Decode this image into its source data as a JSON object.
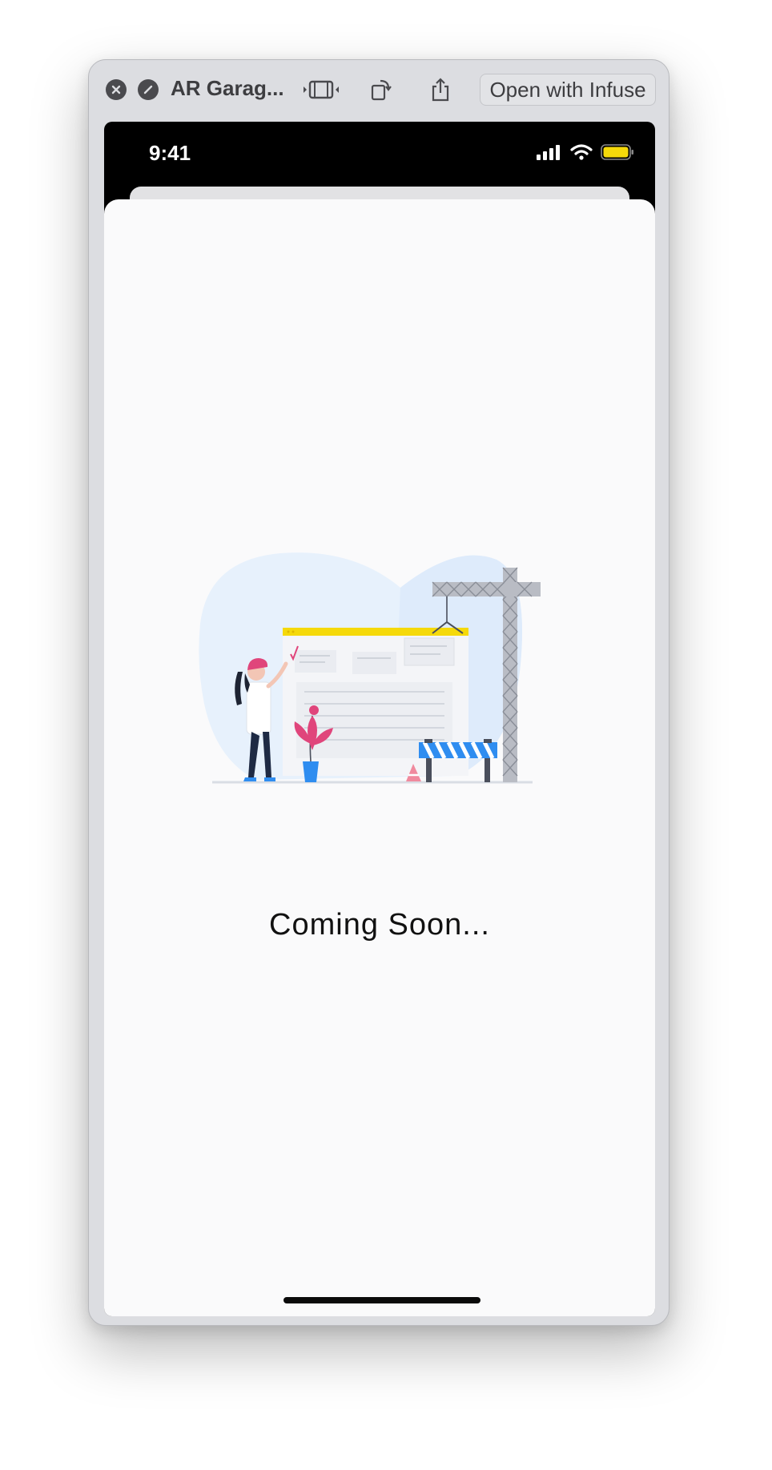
{
  "titlebar": {
    "title": "AR Garag...",
    "open_button_label": "Open with Infuse",
    "icons": [
      "close-icon",
      "block-icon",
      "video-frame-icon",
      "rotate-icon",
      "share-icon"
    ]
  },
  "status_bar": {
    "time": "9:41",
    "icons": [
      "signal-icon",
      "wifi-icon",
      "battery-icon"
    ],
    "battery_color": "#f5d90a"
  },
  "main": {
    "message": "Coming Soon...",
    "illustration": "under-construction-illustration"
  },
  "colors": {
    "window_chrome": "#dcdde1",
    "sheet_background": "#fafafb",
    "accent_yellow": "#f5d90a",
    "accent_blue": "#2f8df0",
    "accent_pink": "#e0457b"
  }
}
